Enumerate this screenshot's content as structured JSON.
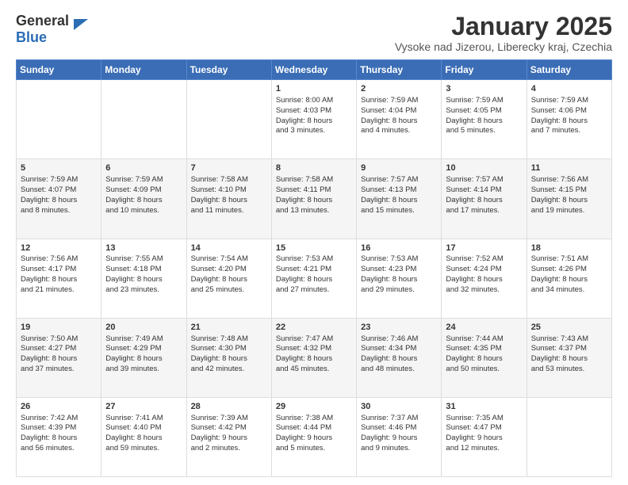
{
  "header": {
    "logo_general": "General",
    "logo_blue": "Blue",
    "month_title": "January 2025",
    "location": "Vysoke nad Jizerou, Liberecky kraj, Czechia"
  },
  "weekdays": [
    "Sunday",
    "Monday",
    "Tuesday",
    "Wednesday",
    "Thursday",
    "Friday",
    "Saturday"
  ],
  "weeks": [
    [
      {
        "day": "",
        "info": ""
      },
      {
        "day": "",
        "info": ""
      },
      {
        "day": "",
        "info": ""
      },
      {
        "day": "1",
        "info": "Sunrise: 8:00 AM\nSunset: 4:03 PM\nDaylight: 8 hours\nand 3 minutes."
      },
      {
        "day": "2",
        "info": "Sunrise: 7:59 AM\nSunset: 4:04 PM\nDaylight: 8 hours\nand 4 minutes."
      },
      {
        "day": "3",
        "info": "Sunrise: 7:59 AM\nSunset: 4:05 PM\nDaylight: 8 hours\nand 5 minutes."
      },
      {
        "day": "4",
        "info": "Sunrise: 7:59 AM\nSunset: 4:06 PM\nDaylight: 8 hours\nand 7 minutes."
      }
    ],
    [
      {
        "day": "5",
        "info": "Sunrise: 7:59 AM\nSunset: 4:07 PM\nDaylight: 8 hours\nand 8 minutes."
      },
      {
        "day": "6",
        "info": "Sunrise: 7:59 AM\nSunset: 4:09 PM\nDaylight: 8 hours\nand 10 minutes."
      },
      {
        "day": "7",
        "info": "Sunrise: 7:58 AM\nSunset: 4:10 PM\nDaylight: 8 hours\nand 11 minutes."
      },
      {
        "day": "8",
        "info": "Sunrise: 7:58 AM\nSunset: 4:11 PM\nDaylight: 8 hours\nand 13 minutes."
      },
      {
        "day": "9",
        "info": "Sunrise: 7:57 AM\nSunset: 4:13 PM\nDaylight: 8 hours\nand 15 minutes."
      },
      {
        "day": "10",
        "info": "Sunrise: 7:57 AM\nSunset: 4:14 PM\nDaylight: 8 hours\nand 17 minutes."
      },
      {
        "day": "11",
        "info": "Sunrise: 7:56 AM\nSunset: 4:15 PM\nDaylight: 8 hours\nand 19 minutes."
      }
    ],
    [
      {
        "day": "12",
        "info": "Sunrise: 7:56 AM\nSunset: 4:17 PM\nDaylight: 8 hours\nand 21 minutes."
      },
      {
        "day": "13",
        "info": "Sunrise: 7:55 AM\nSunset: 4:18 PM\nDaylight: 8 hours\nand 23 minutes."
      },
      {
        "day": "14",
        "info": "Sunrise: 7:54 AM\nSunset: 4:20 PM\nDaylight: 8 hours\nand 25 minutes."
      },
      {
        "day": "15",
        "info": "Sunrise: 7:53 AM\nSunset: 4:21 PM\nDaylight: 8 hours\nand 27 minutes."
      },
      {
        "day": "16",
        "info": "Sunrise: 7:53 AM\nSunset: 4:23 PM\nDaylight: 8 hours\nand 29 minutes."
      },
      {
        "day": "17",
        "info": "Sunrise: 7:52 AM\nSunset: 4:24 PM\nDaylight: 8 hours\nand 32 minutes."
      },
      {
        "day": "18",
        "info": "Sunrise: 7:51 AM\nSunset: 4:26 PM\nDaylight: 8 hours\nand 34 minutes."
      }
    ],
    [
      {
        "day": "19",
        "info": "Sunrise: 7:50 AM\nSunset: 4:27 PM\nDaylight: 8 hours\nand 37 minutes."
      },
      {
        "day": "20",
        "info": "Sunrise: 7:49 AM\nSunset: 4:29 PM\nDaylight: 8 hours\nand 39 minutes."
      },
      {
        "day": "21",
        "info": "Sunrise: 7:48 AM\nSunset: 4:30 PM\nDaylight: 8 hours\nand 42 minutes."
      },
      {
        "day": "22",
        "info": "Sunrise: 7:47 AM\nSunset: 4:32 PM\nDaylight: 8 hours\nand 45 minutes."
      },
      {
        "day": "23",
        "info": "Sunrise: 7:46 AM\nSunset: 4:34 PM\nDaylight: 8 hours\nand 48 minutes."
      },
      {
        "day": "24",
        "info": "Sunrise: 7:44 AM\nSunset: 4:35 PM\nDaylight: 8 hours\nand 50 minutes."
      },
      {
        "day": "25",
        "info": "Sunrise: 7:43 AM\nSunset: 4:37 PM\nDaylight: 8 hours\nand 53 minutes."
      }
    ],
    [
      {
        "day": "26",
        "info": "Sunrise: 7:42 AM\nSunset: 4:39 PM\nDaylight: 8 hours\nand 56 minutes."
      },
      {
        "day": "27",
        "info": "Sunrise: 7:41 AM\nSunset: 4:40 PM\nDaylight: 8 hours\nand 59 minutes."
      },
      {
        "day": "28",
        "info": "Sunrise: 7:39 AM\nSunset: 4:42 PM\nDaylight: 9 hours\nand 2 minutes."
      },
      {
        "day": "29",
        "info": "Sunrise: 7:38 AM\nSunset: 4:44 PM\nDaylight: 9 hours\nand 5 minutes."
      },
      {
        "day": "30",
        "info": "Sunrise: 7:37 AM\nSunset: 4:46 PM\nDaylight: 9 hours\nand 9 minutes."
      },
      {
        "day": "31",
        "info": "Sunrise: 7:35 AM\nSunset: 4:47 PM\nDaylight: 9 hours\nand 12 minutes."
      },
      {
        "day": "",
        "info": ""
      }
    ]
  ]
}
